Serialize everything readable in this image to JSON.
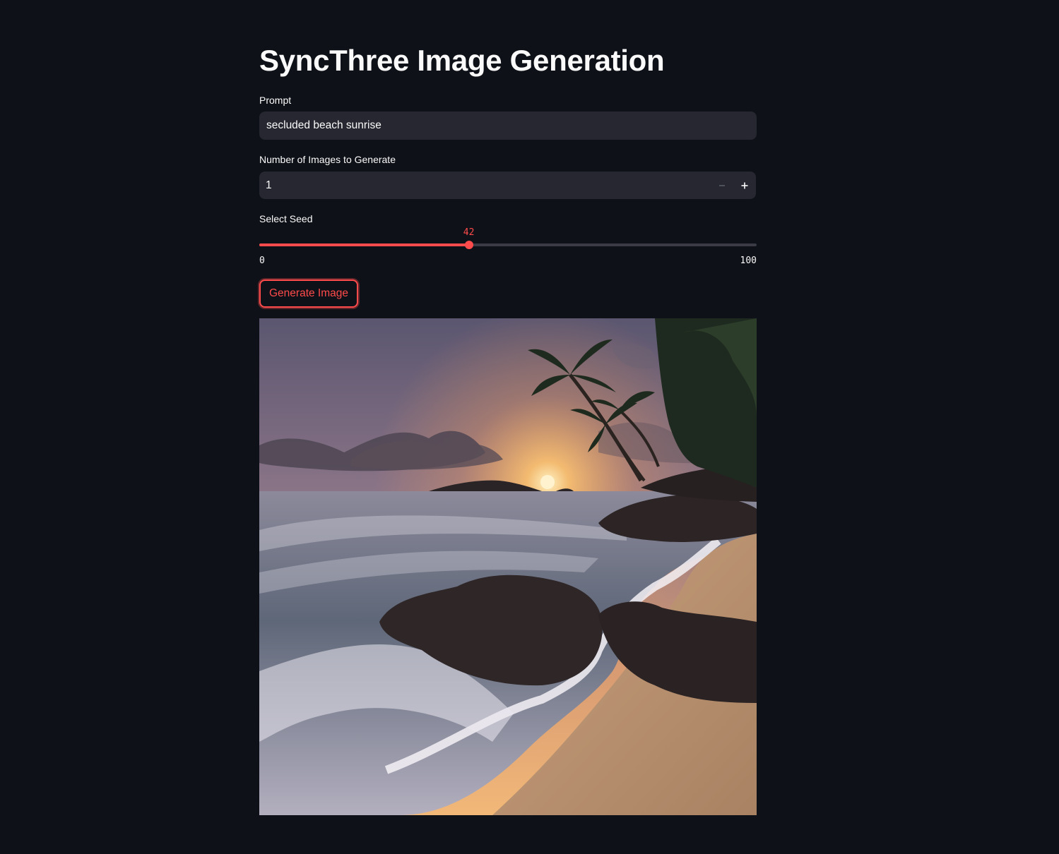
{
  "page": {
    "title": "SyncThree Image Generation"
  },
  "prompt": {
    "label": "Prompt",
    "value": "secluded beach sunrise"
  },
  "num_images": {
    "label": "Number of Images to Generate",
    "value": "1",
    "decrement_icon": "minus-icon",
    "increment_icon": "plus-icon"
  },
  "seed": {
    "label": "Select Seed",
    "value": 42,
    "value_text": "42",
    "min": "0",
    "max": "100"
  },
  "actions": {
    "generate_label": "Generate Image"
  },
  "colors": {
    "background": "#0e1117",
    "input_bg": "#262730",
    "accent": "#ff4b4b",
    "text": "#fafafa"
  }
}
